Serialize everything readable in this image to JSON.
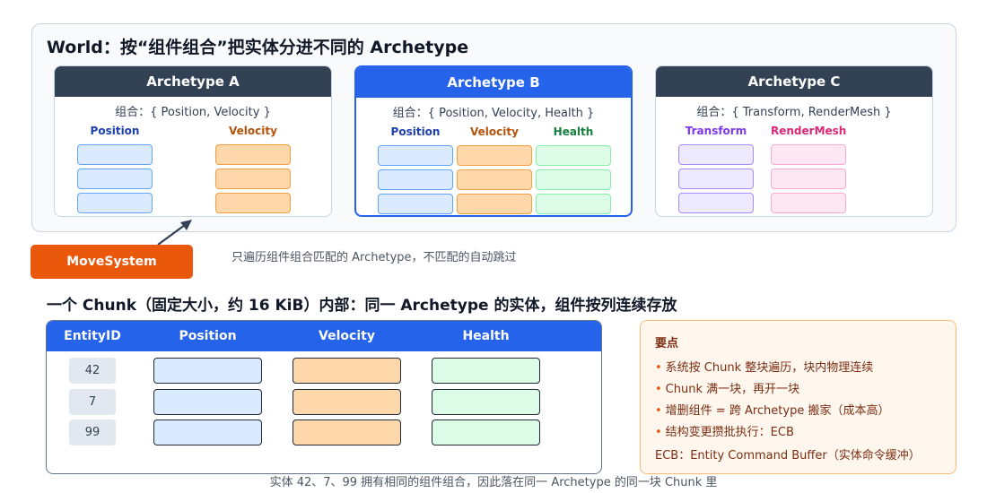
{
  "world": {
    "title": "World：按“组件组合”把实体分进不同的 Archetype"
  },
  "archetypes": [
    {
      "name": "Archetype A",
      "combo": "组合：{ Position, Velocity }",
      "columns": [
        {
          "label": "Position",
          "kind": "pos"
        },
        {
          "label": "Velocity",
          "kind": "vel"
        }
      ]
    },
    {
      "name": "Archetype B",
      "combo": "组合：{ Position, Velocity, Health }",
      "columns": [
        {
          "label": "Position",
          "kind": "pos"
        },
        {
          "label": "Velocity",
          "kind": "vel"
        },
        {
          "label": "Health",
          "kind": "hp"
        }
      ]
    },
    {
      "name": "Archetype C",
      "combo": "组合：{ Transform, RenderMesh }",
      "columns": [
        {
          "label": "Transform",
          "kind": "tr"
        },
        {
          "label": "RenderMesh",
          "kind": "rm"
        }
      ]
    }
  ],
  "move_system": {
    "label": "MoveSystem",
    "note": "只遍历组件组合匹配的 Archetype，不匹配的自动跳过"
  },
  "chunk": {
    "title": "一个 Chunk（固定大小，约 16 KiB）内部：同一 Archetype 的实体，组件按列连续存放",
    "headers": [
      "EntityID",
      "Position",
      "Velocity",
      "Health"
    ],
    "entity_ids": [
      "42",
      "7",
      "99"
    ],
    "caption": "实体 42、7、99 拥有相同的组件组合，因此落在同一 Archetype 的同一块 Chunk 里"
  },
  "keypoints": {
    "title": "要点",
    "items": [
      "系统按 Chunk 整块遍历，块内物理连续",
      "Chunk 满一块，再开一块",
      "增删组件 = 跨 Archetype 搬家（成本高）",
      "结构变更攒批执行：ECB"
    ],
    "footer": "ECB：Entity Command Buffer（实体命令缓冲）"
  },
  "colors": {
    "position": "#dbeafe",
    "velocity": "#fed7aa",
    "health": "#dcfce7",
    "transform": "#ede9fe",
    "rendermesh": "#fce7f3",
    "accent_blue": "#2563eb",
    "accent_orange": "#ea580c",
    "header_dark": "#334155"
  }
}
